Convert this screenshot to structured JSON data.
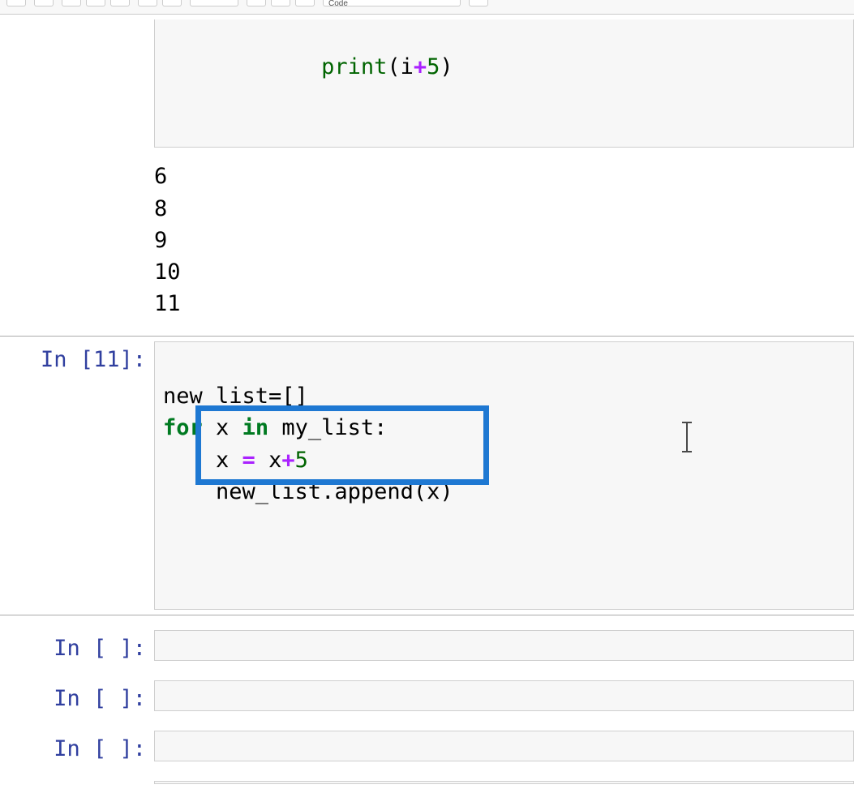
{
  "toolbar": {
    "dropdown_value": "Code"
  },
  "cells": {
    "top_partial": {
      "code_visible": "    print(i+5)"
    },
    "output0": {
      "lines": [
        "6",
        "8",
        "9",
        "10",
        "11"
      ]
    },
    "cell1": {
      "exec_count": "11",
      "prompt": "In [11]:",
      "code": {
        "l1": "new_list=[]",
        "l2_for": "for",
        "l2_x": " x ",
        "l2_in": "in",
        "l2_rest": " my_list:",
        "l3_indent": "    x ",
        "l3_eq": "=",
        "l3_sp": " x",
        "l3_plus": "+",
        "l3_five": "5",
        "l4": "    new_list.append(x)"
      }
    },
    "cell2": {
      "prompt": "In [ ]:"
    },
    "cell3": {
      "prompt": "In [ ]:"
    },
    "cell4": {
      "prompt": "In [ ]:"
    }
  },
  "annotation": {
    "highlight_target": "lines 3-4 of cell In[11]"
  }
}
